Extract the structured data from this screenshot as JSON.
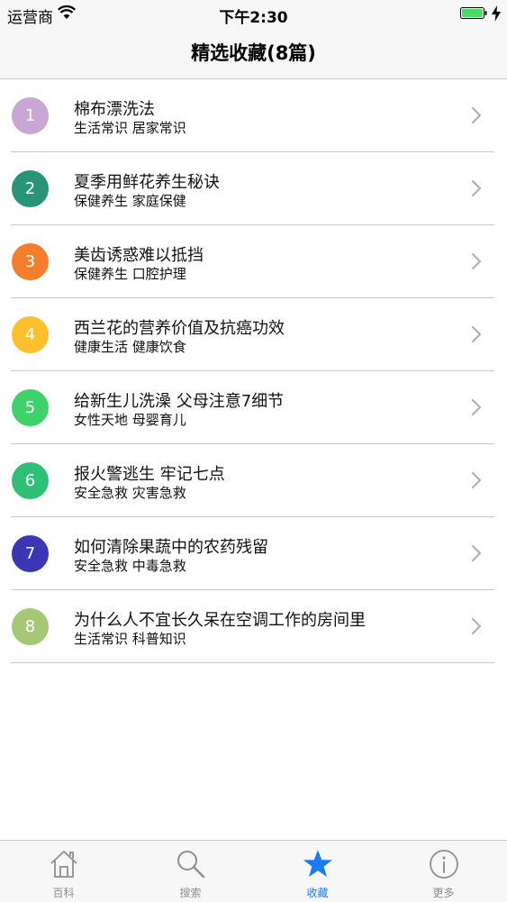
{
  "status_bar": {
    "carrier": "运营商",
    "time": "下午2:30"
  },
  "nav": {
    "title": "精选收藏(8篇)"
  },
  "items": [
    {
      "number": "1",
      "title": "棉布漂洗法",
      "tags": "生活常识 居家常识",
      "color": "#c9a6d4"
    },
    {
      "number": "2",
      "title": "夏季用鲜花养生秘诀",
      "tags": "保健养生 家庭保健",
      "color": "#2a9478"
    },
    {
      "number": "3",
      "title": "美齿诱惑难以抵挡",
      "tags": "保健养生 口腔护理",
      "color": "#f47d2e"
    },
    {
      "number": "4",
      "title": "西兰花的营养价值及抗癌功效",
      "tags": "健康生活 健康饮食",
      "color": "#fcc02d"
    },
    {
      "number": "5",
      "title": "给新生儿洗澡 父母注意7细节",
      "tags": "女性天地 母婴育儿",
      "color": "#3fd16a"
    },
    {
      "number": "6",
      "title": "报火警逃生 牢记七点",
      "tags": "安全急救 灾害急救",
      "color": "#2fbf77"
    },
    {
      "number": "7",
      "title": "如何清除果蔬中的农药残留",
      "tags": "安全急救 中毒急救",
      "color": "#3d36b4"
    },
    {
      "number": "8",
      "title": "为什么人不宜长久呆在空调工作的房间里",
      "tags": "生活常识 科普知识",
      "color": "#a6c874"
    }
  ],
  "tabs": [
    {
      "label": "百科",
      "icon": "home-icon"
    },
    {
      "label": "搜索",
      "icon": "search-icon"
    },
    {
      "label": "收藏",
      "icon": "star-icon",
      "active": true
    },
    {
      "label": "更多",
      "icon": "info-icon"
    }
  ],
  "colors": {
    "accent": "#1a7cf2",
    "battery": "#4cd964"
  }
}
